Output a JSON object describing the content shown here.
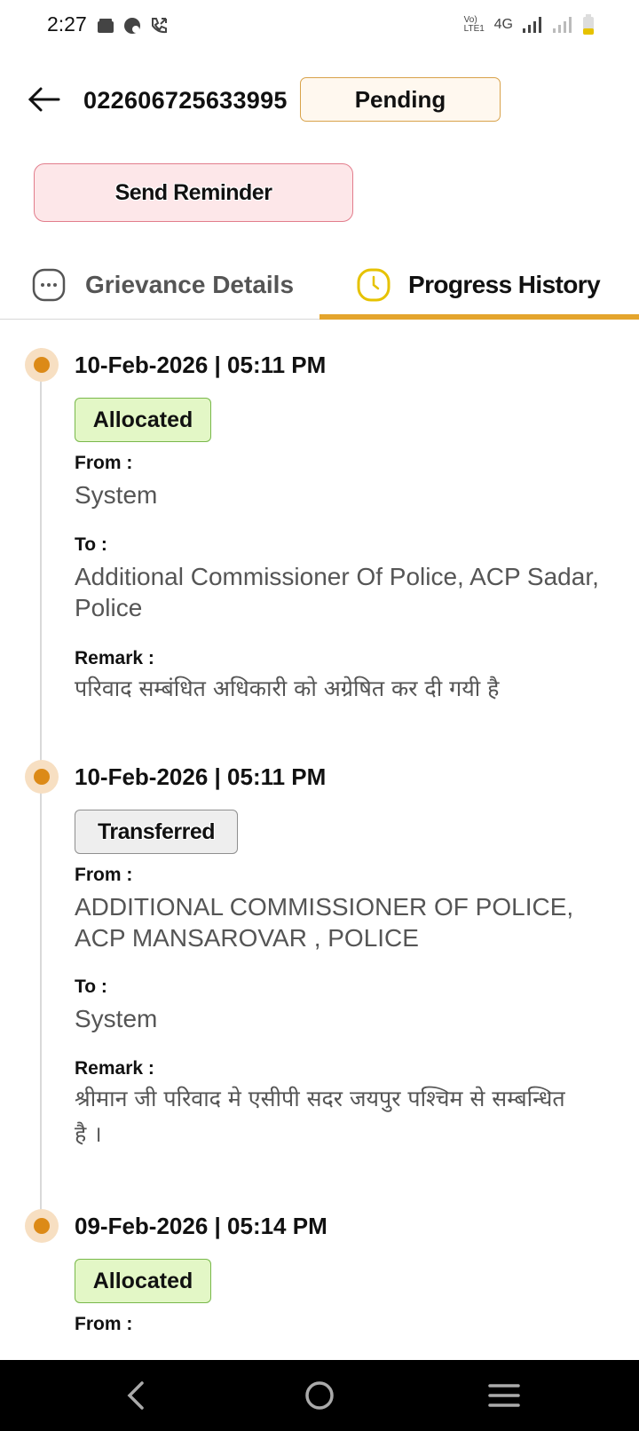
{
  "status_bar": {
    "time": "2:27",
    "network": "4G",
    "volte": "Vo) LTE1",
    "icons": [
      "wallet-icon",
      "chat-icon",
      "call-icon",
      "signal-icon",
      "battery-icon"
    ]
  },
  "header": {
    "grievance_id": "022606725633995",
    "status": "Pending"
  },
  "actions": {
    "send_reminder": "Send Reminder"
  },
  "tabs": [
    {
      "label": "Grievance Details",
      "icon": "dots-chat-icon",
      "active": false
    },
    {
      "label": "Progress History",
      "icon": "clock-icon",
      "active": true
    }
  ],
  "colors": {
    "accent": "#E4A52D",
    "timeline_dot": "#DC8A17",
    "allocated_bg": "#E3F7C6",
    "reminder_bg": "#FDE7E9"
  },
  "timeline": [
    {
      "datetime": "10-Feb-2026 | 05:11 PM",
      "status": "Allocated",
      "from_label": "From :",
      "from": "System",
      "to_label": "To :",
      "to": "Additional Commissioner Of Police, ACP Sadar, Police",
      "remark_label": "Remark :",
      "remark": " परिवाद सम्बंधित अधिकारी को अग्रेषित कर दी गयी है"
    },
    {
      "datetime": "10-Feb-2026 | 05:11 PM",
      "status": "Transferred",
      "from_label": "From :",
      "from": "ADDITIONAL COMMISSIONER OF POLICE, ACP MANSAROVAR , POLICE",
      "to_label": "To :",
      "to": "System",
      "remark_label": "Remark :",
      "remark": "श्रीमान जी परिवाद मे एसीपी सदर जयपुर पश्चिम से सम्बन्धित है ।"
    },
    {
      "datetime": "09-Feb-2026 | 05:14 PM",
      "status": "Allocated",
      "from_label": "From :"
    }
  ]
}
